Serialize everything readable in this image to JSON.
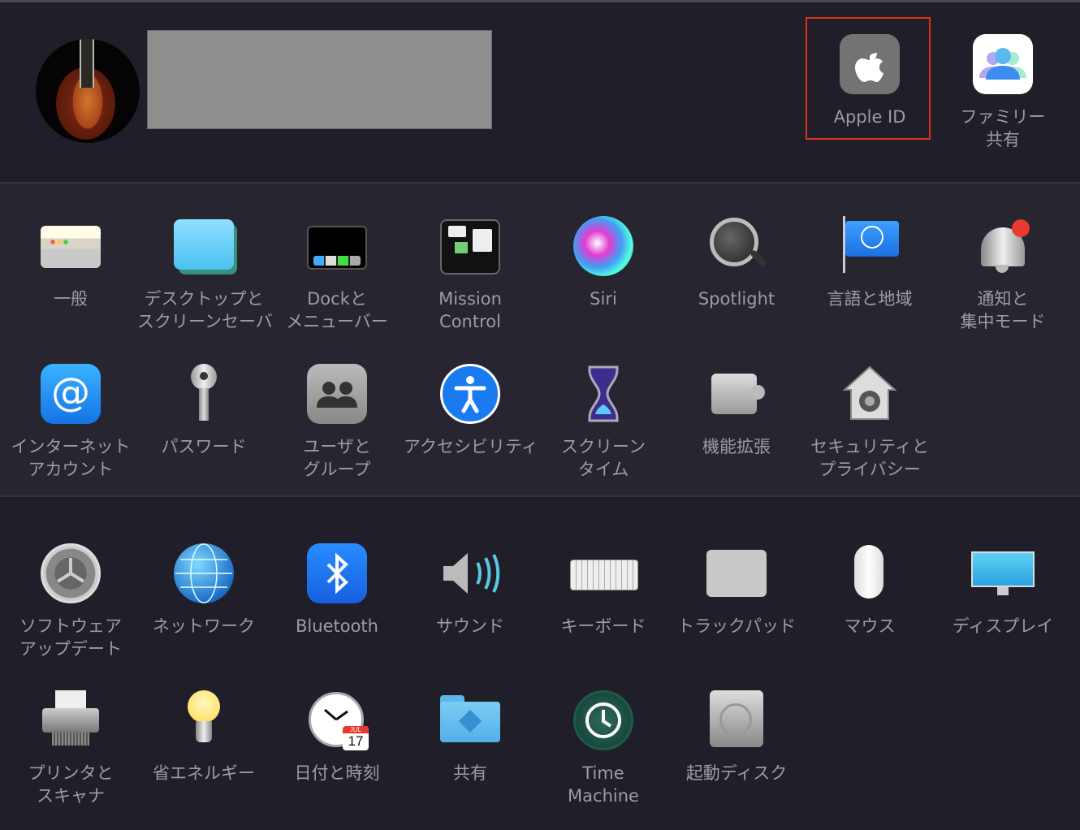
{
  "account": {
    "avatar": "guitar-avatar",
    "name_redacted": true
  },
  "top_items": [
    {
      "id": "apple-id",
      "icon": "apple-logo-icon",
      "lines": [
        "Apple ID"
      ],
      "selected": true,
      "highlight_color": "#d8341c"
    },
    {
      "id": "family-sharing",
      "icon": "family-icon",
      "lines": [
        "ファミリー",
        "共有"
      ]
    }
  ],
  "rows": [
    [
      {
        "id": "general",
        "icon": "general-icon",
        "lines": [
          "一般"
        ]
      },
      {
        "id": "desktop-screensaver",
        "icon": "desktop-icon",
        "lines": [
          "デスクトップと",
          "スクリーンセーバ"
        ]
      },
      {
        "id": "dock-menubar",
        "icon": "dock-icon",
        "lines": [
          "Dockと",
          "メニューバー"
        ]
      },
      {
        "id": "mission-control",
        "icon": "mission-control-icon",
        "lines": [
          "Mission",
          "Control"
        ]
      },
      {
        "id": "siri",
        "icon": "siri-icon",
        "lines": [
          "Siri"
        ]
      },
      {
        "id": "spotlight",
        "icon": "magnifier-icon",
        "lines": [
          "Spotlight"
        ]
      },
      {
        "id": "language-region",
        "icon": "flag-globe-icon",
        "lines": [
          "言語と地域"
        ]
      },
      {
        "id": "notifications-focus",
        "icon": "bell-icon",
        "lines": [
          "通知と",
          "集中モード"
        ]
      }
    ],
    [
      {
        "id": "internet-accounts",
        "icon": "at-icon",
        "lines": [
          "インターネット",
          "アカウント"
        ]
      },
      {
        "id": "passwords",
        "icon": "key-icon",
        "lines": [
          "パスワード"
        ]
      },
      {
        "id": "users-groups",
        "icon": "users-icon",
        "lines": [
          "ユーザと",
          "グループ"
        ]
      },
      {
        "id": "accessibility",
        "icon": "accessibility-icon",
        "lines": [
          "アクセシビリティ"
        ]
      },
      {
        "id": "screen-time",
        "icon": "hourglass-icon",
        "lines": [
          "スクリーン",
          "タイム"
        ]
      },
      {
        "id": "extensions",
        "icon": "puzzle-icon",
        "lines": [
          "機能拡張"
        ]
      },
      {
        "id": "security-privacy",
        "icon": "house-lock-icon",
        "lines": [
          "セキュリティと",
          "プライバシー"
        ]
      }
    ],
    [
      {
        "id": "software-update",
        "icon": "gear-icon",
        "lines": [
          "ソフトウェア",
          "アップデート"
        ]
      },
      {
        "id": "network",
        "icon": "globe-icon",
        "lines": [
          "ネットワーク"
        ]
      },
      {
        "id": "bluetooth",
        "icon": "bluetooth-icon",
        "lines": [
          "Bluetooth"
        ]
      },
      {
        "id": "sound",
        "icon": "speaker-icon",
        "lines": [
          "サウンド"
        ]
      },
      {
        "id": "keyboard",
        "icon": "keyboard-icon",
        "lines": [
          "キーボード"
        ]
      },
      {
        "id": "trackpad",
        "icon": "trackpad-icon",
        "lines": [
          "トラックパッド"
        ]
      },
      {
        "id": "mouse",
        "icon": "mouse-icon",
        "lines": [
          "マウス"
        ]
      },
      {
        "id": "displays",
        "icon": "display-icon",
        "lines": [
          "ディスプレイ"
        ]
      }
    ],
    [
      {
        "id": "printers-scanners",
        "icon": "printer-icon",
        "lines": [
          "プリンタと",
          "スキャナ"
        ]
      },
      {
        "id": "energy-saver",
        "icon": "lightbulb-icon",
        "lines": [
          "省エネルギー"
        ]
      },
      {
        "id": "date-time",
        "icon": "clock-calendar-icon",
        "lines": [
          "日付と時刻"
        ],
        "calendar": {
          "month": "JUL",
          "day": "17"
        }
      },
      {
        "id": "sharing",
        "icon": "shared-folder-icon",
        "lines": [
          "共有"
        ]
      },
      {
        "id": "time-machine",
        "icon": "time-machine-icon",
        "lines": [
          "Time",
          "Machine"
        ]
      },
      {
        "id": "startup-disk",
        "icon": "hard-disk-icon",
        "lines": [
          "起動ディスク"
        ]
      }
    ]
  ]
}
